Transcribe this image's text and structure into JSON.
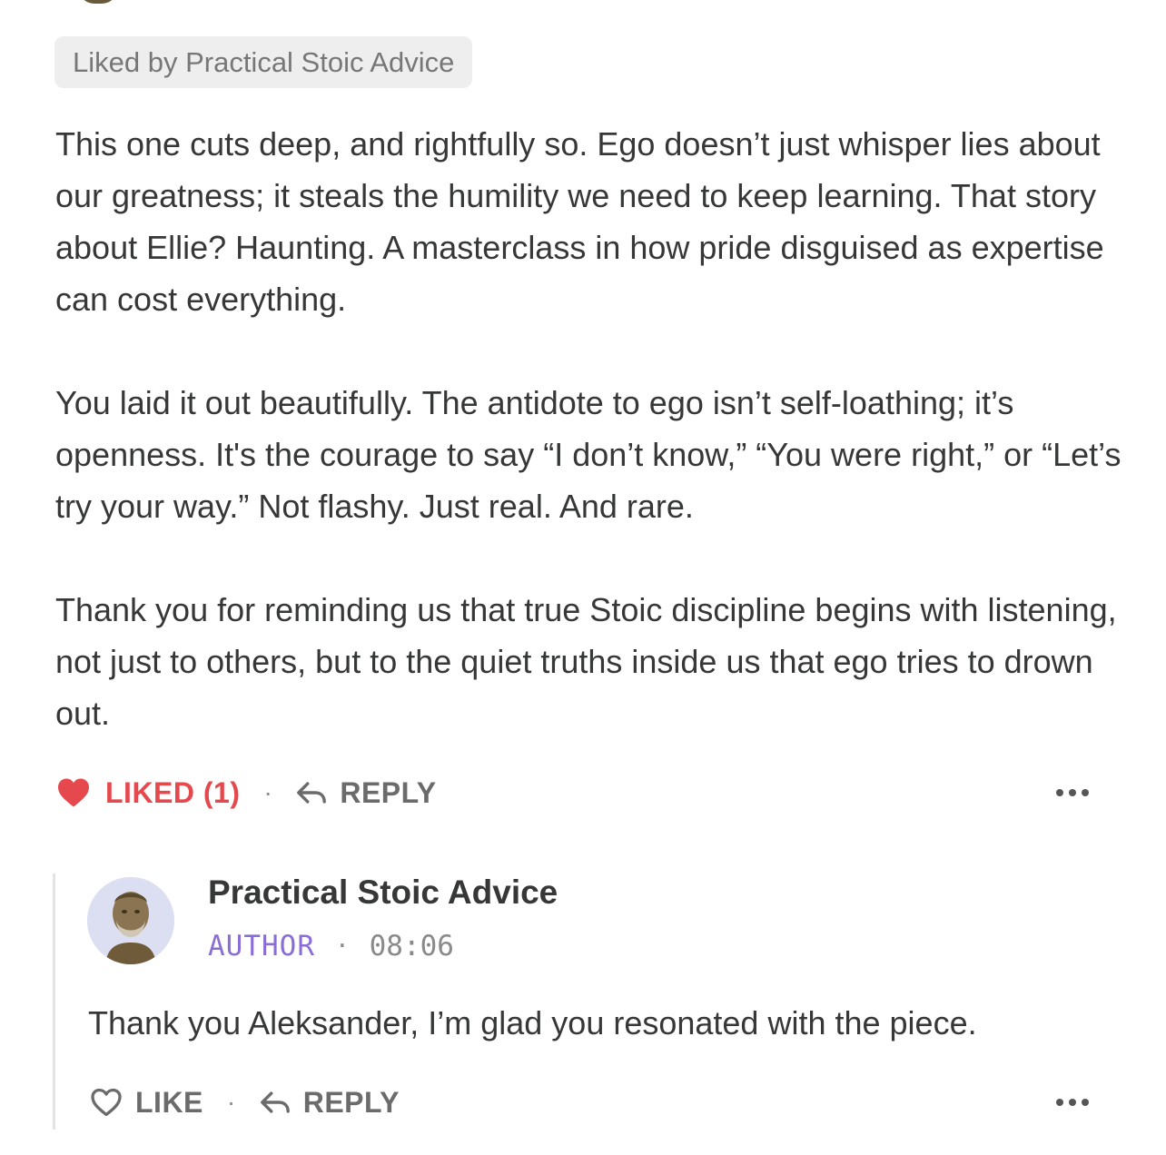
{
  "liked_by": "Liked by Practical Stoic Advice",
  "comment": {
    "paragraphs": [
      "This one cuts deep, and rightfully so. Ego doesn’t just whisper lies about our greatness; it steals the humility we need to keep learning. That story about Ellie? Haunting. A masterclass in how pride disguised as expertise can cost everything.",
      "You laid it out beautifully. The antidote to ego isn’t self-loathing; it’s openness. It's the courage to say “I don’t know,” “You were right,” or “Let’s try your way.” Not flashy. Just real. And rare.",
      "Thank you for reminding us that true Stoic discipline begins with listening, not just to others, but to the quiet truths inside us that ego tries to drown out."
    ],
    "actions": {
      "liked_label": "LIKED (1)",
      "separator": "·",
      "reply_label": "REPLY"
    }
  },
  "reply": {
    "author": "Practical Stoic Advice",
    "badge": "AUTHOR",
    "separator": "·",
    "time": "08:06",
    "text": "Thank you Aleksander, I’m glad you resonated with the piece.",
    "actions": {
      "like_label": "LIKE",
      "separator": "·",
      "reply_label": "REPLY"
    }
  },
  "colors": {
    "liked": "#e5484d",
    "author_badge": "#8a6ed6",
    "body_text": "#363737",
    "muted": "#6b6b6b"
  },
  "icons": {
    "liked": "heart-filled-icon",
    "like": "heart-outline-icon",
    "reply": "reply-arrow-icon",
    "more": "more-horizontal-icon"
  }
}
